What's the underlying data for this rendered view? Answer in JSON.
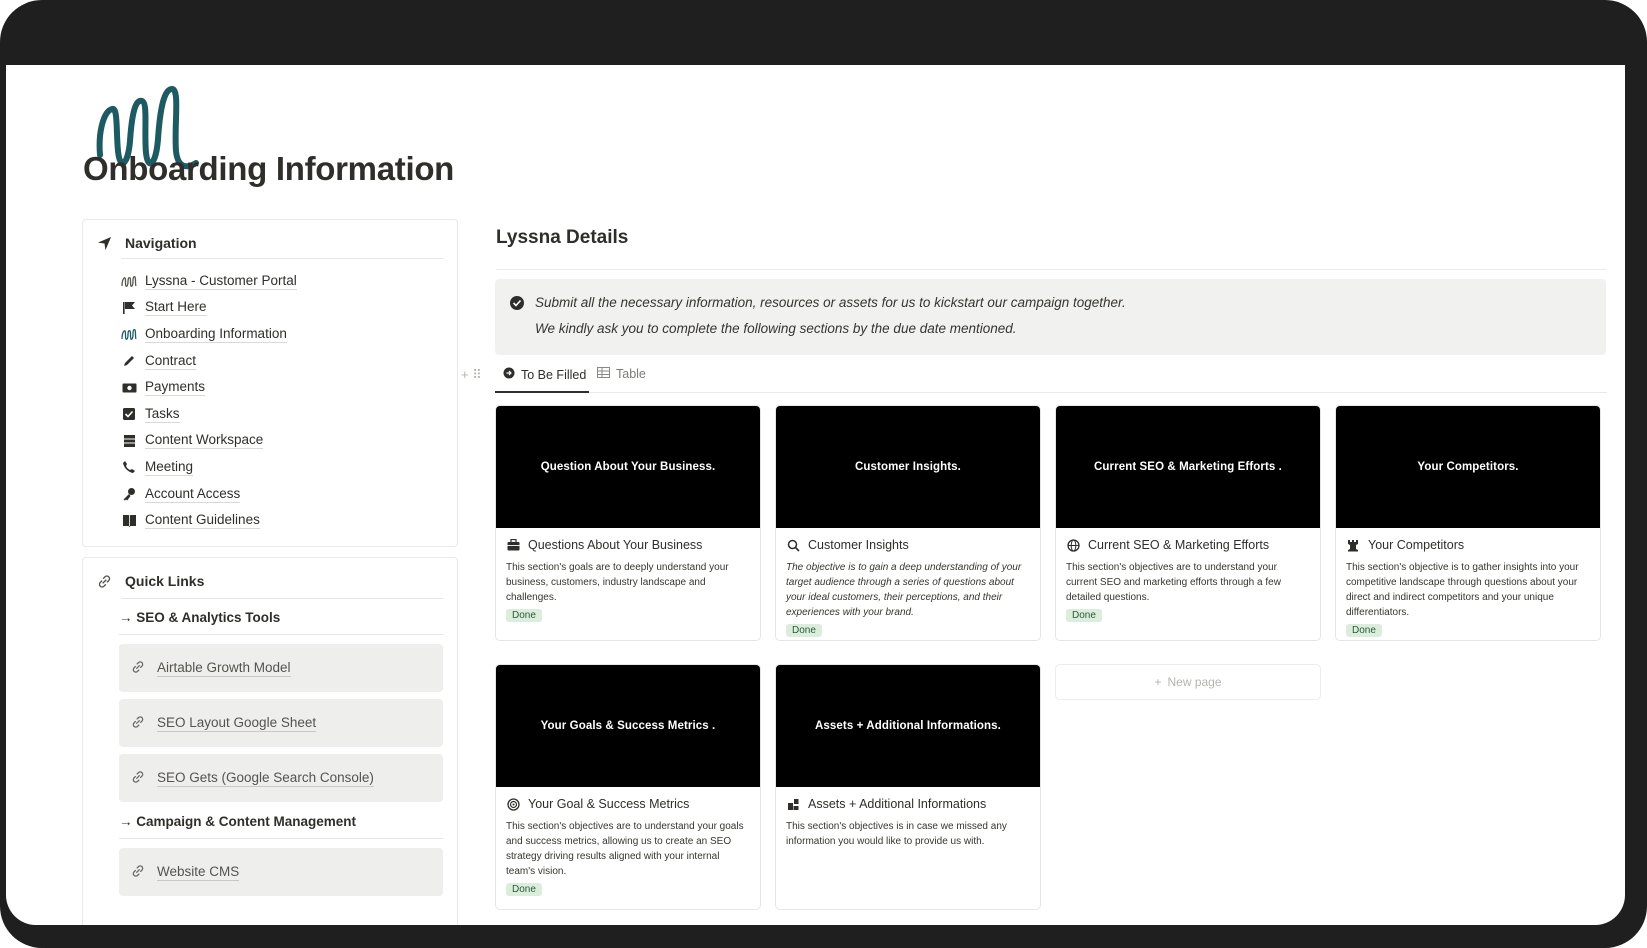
{
  "page": {
    "title": "Onboarding Information"
  },
  "navigation": {
    "heading": "Navigation",
    "items": [
      {
        "label": "Lyssna - Customer Portal",
        "icon": "logo-mini-icon"
      },
      {
        "label": "Start Here",
        "icon": "flag-icon"
      },
      {
        "label": "Onboarding Information",
        "icon": "logo-mini-icon"
      },
      {
        "label": "Contract",
        "icon": "pencil-icon"
      },
      {
        "label": "Payments",
        "icon": "money-icon"
      },
      {
        "label": "Tasks",
        "icon": "checkbox-icon"
      },
      {
        "label": "Content Workspace",
        "icon": "cabinet-icon"
      },
      {
        "label": "Meeting",
        "icon": "phone-icon"
      },
      {
        "label": "Account Access",
        "icon": "key-icon"
      },
      {
        "label": "Content Guidelines",
        "icon": "book-icon"
      }
    ]
  },
  "quick_links": {
    "heading": "Quick Links",
    "group1": "→ SEO & Analytics Tools",
    "group1_links": [
      "Airtable Growth Model",
      "SEO Layout Google Sheet",
      "SEO Gets (Google Search Console)"
    ],
    "group2": "→ Campaign & Content Management",
    "group2_links": [
      "Website CMS"
    ]
  },
  "details": {
    "title": "Lyssna Details",
    "callout_line1": "Submit all the necessary information, resources or assets for us to kickstart our campaign together.",
    "callout_line2": "We kindly ask you to complete the following sections by the due date mentioned.",
    "view_tabs": [
      "To Be Filled",
      "Table"
    ],
    "new_page": "New page"
  },
  "cards": [
    {
      "cover": "Question About Your Business.",
      "title": "Questions About Your Business",
      "icon": "briefcase-icon",
      "desc": "This section's goals are to deeply understand your business, customers, industry landscape and challenges.",
      "status": "Done"
    },
    {
      "cover": "Customer Insights.",
      "title": "Customer Insights",
      "icon": "magnifier-icon",
      "desc": "The objective is to gain a deep understanding of your target audience through a series of questions about your ideal customers, their perceptions, and their experiences with your brand.",
      "status": "Done"
    },
    {
      "cover": "Current SEO & Marketing Efforts .",
      "title": "Current SEO & Marketing Efforts",
      "icon": "globe-icon",
      "desc": "This section's objectives are to understand your current SEO and marketing efforts through a few detailed questions.",
      "status": "Done"
    },
    {
      "cover": "Your Competitors.",
      "title": "Your Competitors",
      "icon": "chess-rook-icon",
      "desc": "This section's objective is to gather insights into your competitive landscape through questions about your direct and indirect competitors and your unique differentiators.",
      "status": "Done"
    },
    {
      "cover": "Your Goals & Success Metrics .",
      "title": "Your Goal & Success Metrics",
      "icon": "target-icon",
      "desc": "This section's objectives are to understand your goals and success metrics, allowing us to create an SEO strategy driving results aligned with your internal team's vision.",
      "status": "Done"
    },
    {
      "cover": "Assets + Additional Informations.",
      "title": "Assets + Additional Informations",
      "icon": "blocks-icon",
      "desc": "This section's objectives is in case we missed any information you would like to provide us with.",
      "status": ""
    }
  ],
  "colors": {
    "frame": "#1f1f1f",
    "cover": "#000000",
    "badge_bg": "#dbeddb",
    "badge_text": "#2b593f",
    "logo": "#1d5a62"
  }
}
